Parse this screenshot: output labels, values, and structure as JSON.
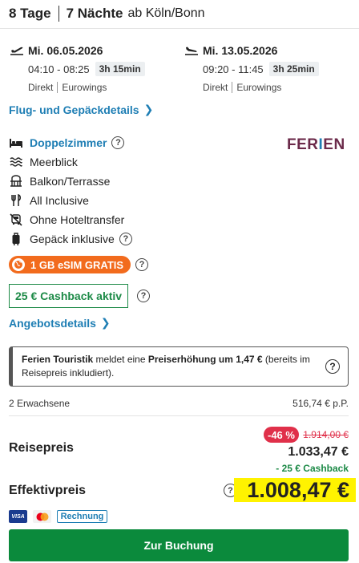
{
  "header": {
    "days": "8 Tage",
    "nights": "7 Nächte",
    "departure": "ab Köln/Bonn"
  },
  "outbound": {
    "date": "Mi. 06.05.2026",
    "times": "04:10 - 08:25",
    "duration": "3h 15min",
    "type": "Direkt",
    "airline": "Eurowings",
    "icon": "plane-departure-icon"
  },
  "return": {
    "date": "Mi. 13.05.2026",
    "times": "09:20 - 11:45",
    "duration": "3h 25min",
    "type": "Direkt",
    "airline": "Eurowings",
    "icon": "plane-arrival-icon"
  },
  "flight_details_link": "Flug- und Gepäckdetails",
  "features": {
    "room": "Doppelzimmer",
    "view": "Meerblick",
    "balcony": "Balkon/Terrasse",
    "board": "All Inclusive",
    "transfer": "Ohne Hoteltransfer",
    "luggage": "Gepäck inklusive"
  },
  "operator_logo": {
    "prefix": "FER",
    "highlight": "I",
    "suffix": "EN"
  },
  "esim_badge": "1 GB eSIM GRATIS",
  "cashback_badge": "25 € Cashback aktiv",
  "offer_details_link": "Angebotsdetails",
  "notice": {
    "operator": "Ferien Touristik",
    "text1": " meldet eine ",
    "emphasis": "Preiserhöhung um 1,47 €",
    "text2": " (bereits im Reisepreis inkludiert)."
  },
  "pax": {
    "label": "2 Erwachsene",
    "per_person": "516,74 € p.P."
  },
  "pricing": {
    "reisepreis_label": "Reisepreis",
    "discount": "-46 %",
    "old_price": "1.914,00 €",
    "price": "1.033,47 €",
    "cashback": "- 25 € Cashback",
    "effektiv_label": "Effektivpreis",
    "effektiv_price": "1.008,47 €"
  },
  "payment": {
    "visa": "VISA",
    "invoice": "Rechnung"
  },
  "book_button": "Zur Buchung",
  "colors": {
    "link": "#1e7eb4",
    "green": "#0b8a3c",
    "orange": "#f26b1d",
    "red": "#e0304a",
    "highlight": "#fff300"
  }
}
